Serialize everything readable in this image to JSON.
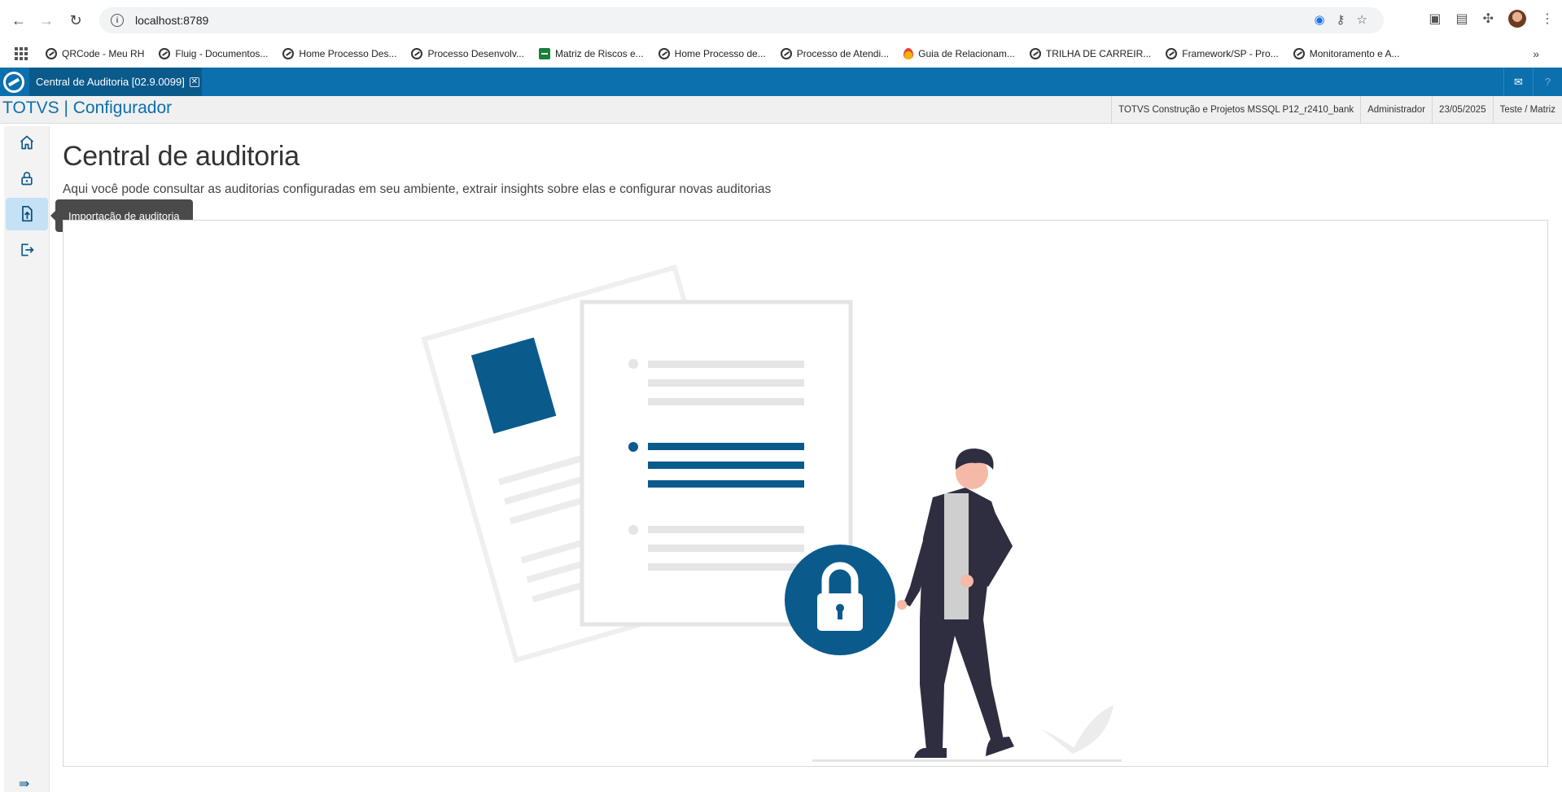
{
  "browser": {
    "url": "localhost:8789",
    "bookmarks": [
      {
        "label": "QRCode - Meu RH",
        "icon": "circle-logo"
      },
      {
        "label": "Fluig - Documentos...",
        "icon": "circle-logo"
      },
      {
        "label": "Home Processo Des...",
        "icon": "circle-logo"
      },
      {
        "label": "Processo Desenvolv...",
        "icon": "circle-logo"
      },
      {
        "label": "Matriz de Riscos e...",
        "icon": "sheet"
      },
      {
        "label": "Home Processo de...",
        "icon": "circle-logo"
      },
      {
        "label": "Processo de Atendi...",
        "icon": "circle-logo"
      },
      {
        "label": "Guia de Relacionam...",
        "icon": "drop"
      },
      {
        "label": "TRILHA DE CARREIR...",
        "icon": "circle-logo"
      },
      {
        "label": "Framework/SP - Pro...",
        "icon": "circle-logo"
      },
      {
        "label": "Monitoramento e A...",
        "icon": "circle-logo"
      }
    ]
  },
  "app": {
    "tab_title": "Central de Auditoria [02.9.0099]",
    "tab_close": "✕",
    "brand": "TOTVS | Configurador",
    "info": {
      "environment": "TOTVS Construção e Projetos MSSQL P12_r2410_bank",
      "user": "Administrador",
      "date": "23/05/2025",
      "company": "Teste / Matriz"
    }
  },
  "sidebar": {
    "items": [
      {
        "name": "home",
        "icon": "home-icon"
      },
      {
        "name": "lock",
        "icon": "lock-icon"
      },
      {
        "name": "import",
        "icon": "file-upload-icon",
        "active": true
      },
      {
        "name": "logout",
        "icon": "logout-icon"
      }
    ],
    "tooltip": "Importação de auditoria"
  },
  "page": {
    "title": "Central de auditoria",
    "description": "Aqui você pode consultar as auditorias configuradas em seu ambiente, extrair insights sobre elas e configurar novas auditorias"
  },
  "colors": {
    "accent": "#0c6fae",
    "accent_dark": "#0a5a8c",
    "illustration_blue": "#0a5a8c"
  }
}
